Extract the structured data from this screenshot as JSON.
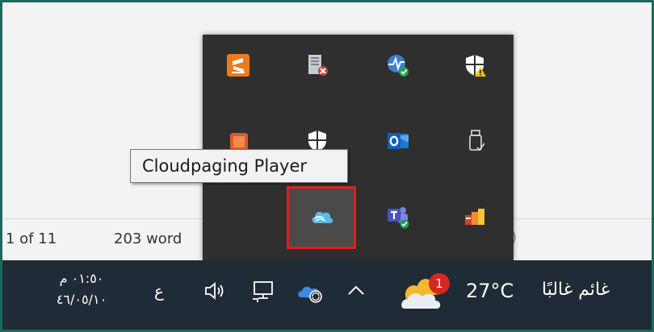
{
  "statusbar": {
    "pages": "1 of 11",
    "words": "203 word",
    "right_fragment": ")"
  },
  "tooltip": {
    "text": "Cloudpaging Player"
  },
  "tray": {
    "icons": [
      {
        "name": "sublime-like-orange-icon"
      },
      {
        "name": "task-manager-icon"
      },
      {
        "name": "network-monitor-check-icon"
      },
      {
        "name": "windows-security-warning-icon"
      },
      {
        "name": "office-orange-icon"
      },
      {
        "name": "windows-security-icon"
      },
      {
        "name": "outlook-icon"
      },
      {
        "name": "usb-safe-remove-icon"
      },
      {
        "name": "cloudpaging-player-icon"
      },
      {
        "name": "teams-icon"
      },
      {
        "name": "color-bars-icon"
      }
    ],
    "selected_color": "#e0201c"
  },
  "taskbar": {
    "time": "٠١:٥٠ م",
    "date": "٤٦/٠٥/١٠",
    "lang": "ع",
    "temperature": "27°C",
    "weather": "غائم غالبًا",
    "notification_count": "1",
    "bg_color": "#1f2b36"
  }
}
